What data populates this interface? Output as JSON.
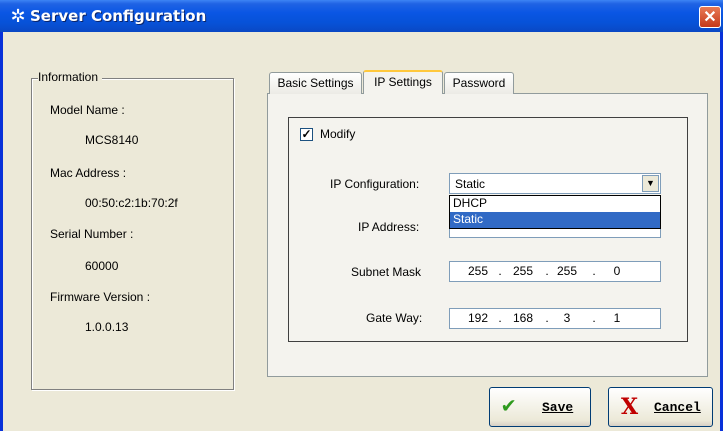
{
  "window": {
    "title": "Server Configuration",
    "close_glyph": "✕",
    "icon": "gear-icon"
  },
  "info": {
    "legend": "Information",
    "model_name_label": "Model Name :",
    "model_name_value": "MCS8140",
    "mac_label": "Mac Address :",
    "mac_value": "00:50:c2:1b:70:2f",
    "serial_label": "Serial Number :",
    "serial_value": "60000",
    "firmware_label": "Firmware Version :",
    "firmware_value": "1.0.0.13"
  },
  "tabs": [
    {
      "label": "Basic Settings"
    },
    {
      "label": "IP Settings"
    },
    {
      "label": "Password"
    }
  ],
  "ip_settings": {
    "modify_label": "Modify",
    "modify_checked": "✓",
    "ip_config_label": "IP Configuration:",
    "ip_config_value": "Static",
    "ip_config_options": [
      "DHCP",
      "Static"
    ],
    "ip_address_label": "IP Address:",
    "subnet_label": "Subnet Mask",
    "subnet_parts": [
      "255",
      "255",
      "255",
      "0"
    ],
    "gateway_label": "Gate Way:",
    "gateway_parts": [
      "192",
      "168",
      "3",
      "1"
    ]
  },
  "buttons": {
    "save_label": "Save",
    "cancel_label": "Cancel",
    "save_icon": "checkmark-icon",
    "cancel_icon": "x-icon"
  },
  "colors": {
    "title_bar": "#0a56e4",
    "selection": "#316ac5",
    "tab_highlight": "#ffc83c"
  }
}
